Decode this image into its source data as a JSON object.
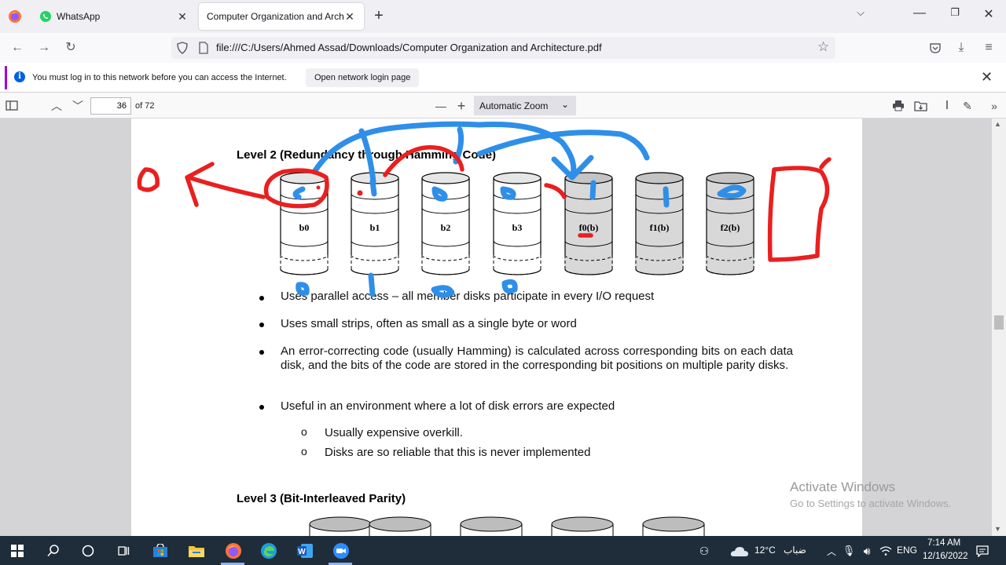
{
  "browser": {
    "tabs": [
      {
        "title": "WhatsApp"
      },
      {
        "title": "Computer Organization and Archite"
      }
    ],
    "new_tab": "+",
    "url": "file:///C:/Users/Ahmed Assad/Downloads/Computer Organization and Architecture.pdf"
  },
  "notification": {
    "message": "You must log in to this network before you can access the Internet.",
    "button": "Open network login page"
  },
  "pdf_toolbar": {
    "page_number": "36",
    "page_of": "of 72",
    "zoom": "Automatic Zoom",
    "zoom_out": "—",
    "zoom_in": "+"
  },
  "document": {
    "level2_heading": "Level 2 (Redundancy through Hamming Code)",
    "disk_labels": [
      "b0",
      "b1",
      "b2",
      "b3",
      "f0(b)",
      "f1(b)",
      "f2(b)"
    ],
    "bullets": [
      "Uses parallel access – all member disks participate in every I/O request",
      "Uses small strips, often as small as a single byte or word",
      "An error-correcting code (usually Hamming) is calculated across corresponding bits on each data disk, and the bits of the code are stored in the corresponding bit positions on multiple parity disks.",
      "Useful in an environment where a lot of disk errors are expected"
    ],
    "sub_bullets": [
      "Usually expensive overkill.",
      "Disks are so reliable that this is never implemented"
    ],
    "level3_heading": "Level 3 (Bit-Interleaved Parity)"
  },
  "watermark": {
    "line1": "Activate Windows",
    "line2": "Go to Settings to activate Windows."
  },
  "taskbar": {
    "weather": "12°C",
    "weather_text": "ضباب",
    "lang": "ENG",
    "time": "7:14 AM",
    "date": "12/16/2022"
  },
  "colors": {
    "ink_blue": "#2f8fe8",
    "ink_red": "#ea1f1f",
    "taskbar": "#1f2d3a"
  }
}
